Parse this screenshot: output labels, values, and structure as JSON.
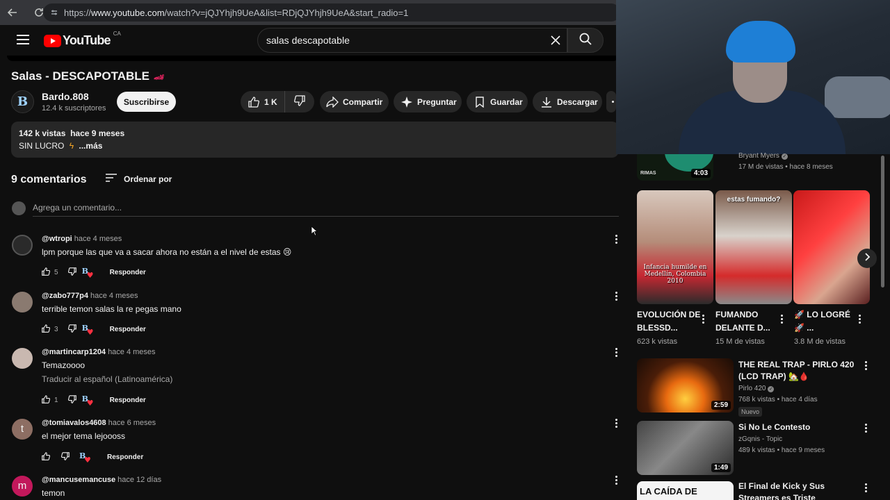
{
  "browser": {
    "url_prefix": "https://",
    "url_host": "www.youtube.com",
    "url_path": "/watch?v=jQJYhjh9UeA&list=RDjQJYhjh9UeA&start_radio=1"
  },
  "header": {
    "logo_text": "YouTube",
    "country": "CA",
    "search_value": "salas descapotable"
  },
  "video": {
    "title": "Salas - DESCAPOTABLE",
    "channel_name": "Bardo.808",
    "channel_initial": "B",
    "subscribers": "12.4 k suscriptores",
    "subscribe_label": "Suscribirse",
    "likes": "1 K",
    "share_label": "Compartir",
    "ask_label": "Preguntar",
    "save_label": "Guardar",
    "download_label": "Descargar",
    "description": {
      "views": "142 k vistas",
      "age": "hace 9 meses",
      "line2": "SIN LUCRO",
      "more": "...más"
    }
  },
  "comments": {
    "count_label": "9 comentarios",
    "sort_label": "Ordenar por",
    "add_placeholder": "Agrega un comentario...",
    "reply_label": "Responder",
    "items": [
      {
        "user": "@wtropi",
        "time": "hace 4 meses",
        "text": "lpm porque las que va a sacar ahora no están a el nivel de estas 😢",
        "likes": "5",
        "avatar_color": "#2a2a2a"
      },
      {
        "user": "@zabo777p4",
        "time": "hace 4 meses",
        "text": "terrible temon salas la re pegas mano",
        "likes": "3",
        "avatar_color": "#8a7a70"
      },
      {
        "user": "@martincarp1204",
        "time": "hace 4 meses",
        "text": "Temazoooo",
        "translate": "Traducir al español (Latinoamérica)",
        "likes": "1",
        "avatar_color": "#c9b8b0"
      },
      {
        "user": "@tomiavalos4608",
        "time": "hace 6 meses",
        "text": "el mejor tema lejoooss",
        "likes": "",
        "avatar_letter": "t",
        "avatar_color": "#8d6e63"
      },
      {
        "user": "@mancusemancuse",
        "time": "hace 12 días",
        "text": "temon",
        "avatar_letter": "m",
        "avatar_color": "#c2185b"
      }
    ]
  },
  "sidebar": {
    "top_video": {
      "thumb_text": "RIMAS",
      "duration": "4:03",
      "channel": "Bryant Myers",
      "meta": "17 M de vistas • hace 8 meses"
    },
    "shorts": [
      {
        "title": "EVOLUCIÓN DE BLESSD...",
        "views": "623 k vistas",
        "caption": "Infancia humilde en Medellín, Colombia 2010"
      },
      {
        "title": "FUMANDO DELANTE D...",
        "views": "15 M de vistas",
        "caption": "estas fumando?"
      },
      {
        "title": "🚀 LO LOGRÉ 🚀 ...",
        "views": "3.8 M de vistas",
        "caption": ""
      }
    ],
    "videos": [
      {
        "title": "THE REAL TRAP - PIRLO 420 (LCD TRAP) 🏡🩸",
        "channel": "Pirlo 420",
        "meta": "768 k vistas • hace 4 días",
        "badge": "Nuevo",
        "duration": "2:59"
      },
      {
        "title": "Si No Le Contesto",
        "channel": "zGqnis - Topic",
        "meta": "489 k vistas • hace 9 meses",
        "duration": "1:49"
      },
      {
        "title": "El Final de Kick y Sus Streamers es Triste",
        "thumb_text": "LA CAÍDA DE"
      }
    ]
  }
}
